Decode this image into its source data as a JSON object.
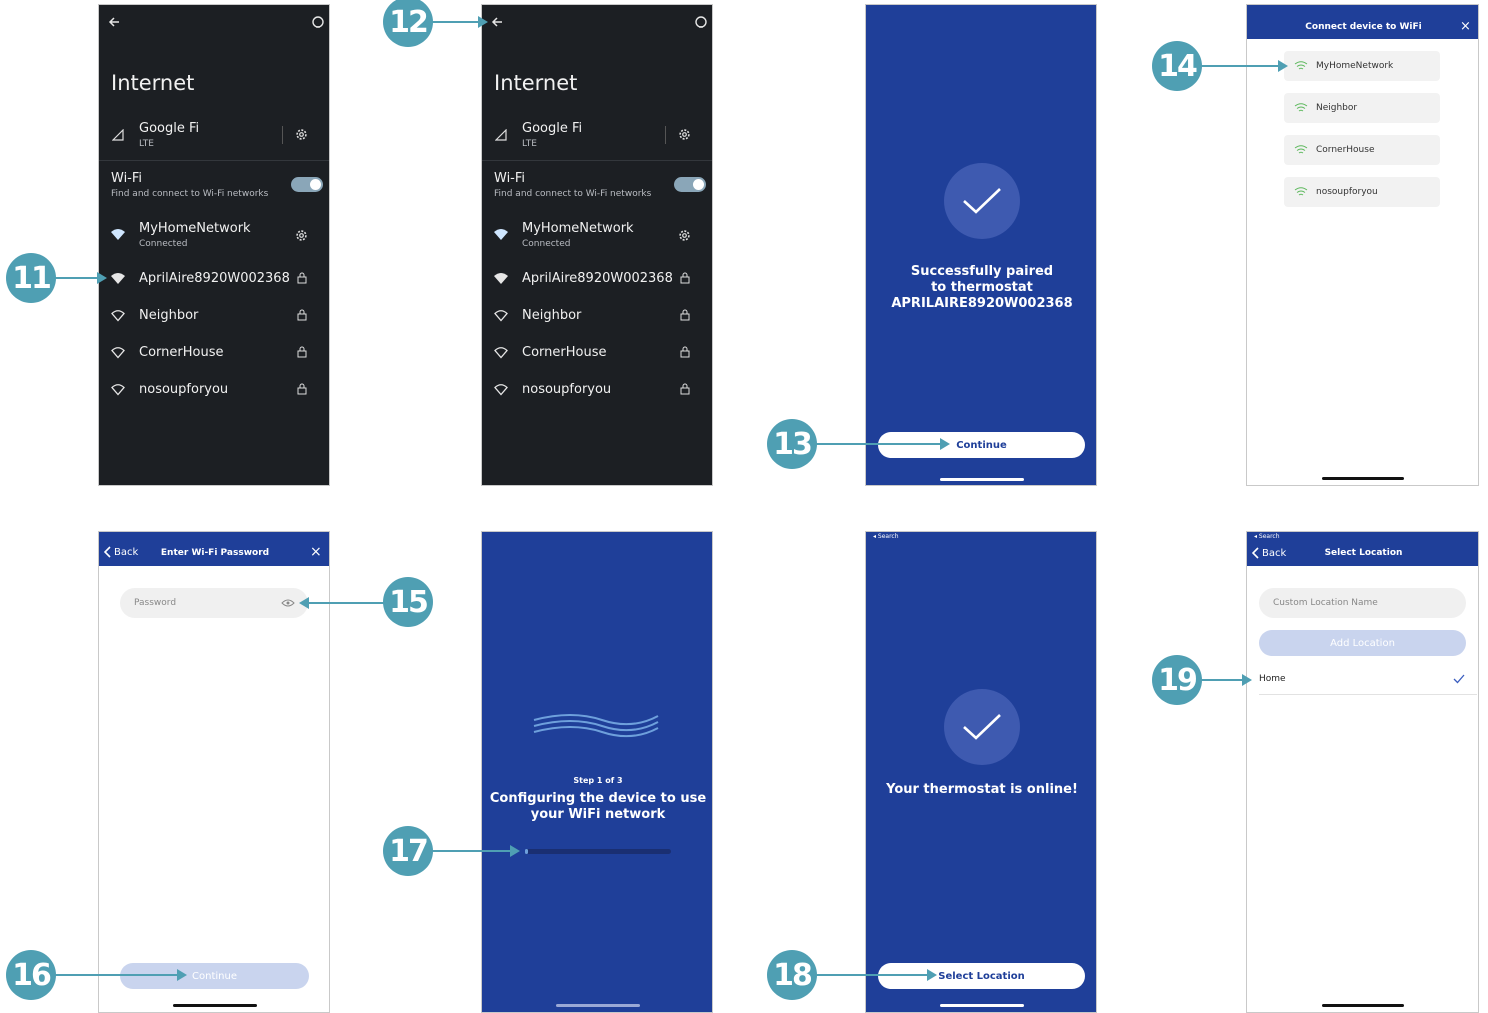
{
  "colors": {
    "accent": "#4f9fb3",
    "brand_blue": "#1f3f99",
    "dark_bg": "#1c1f23",
    "wifi_green": "#5cb85c"
  },
  "screen1": {
    "title": "Internet",
    "carrier": {
      "name": "Google Fi",
      "sub": "LTE"
    },
    "wifi": {
      "label": "Wi-Fi",
      "sub": "Find and connect to Wi-Fi networks"
    },
    "connected": {
      "name": "MyHomeNetwork",
      "sub": "Connected"
    },
    "networks": [
      "AprilAire8920W002368",
      "Neighbor",
      "CornerHouse",
      "nosoupforyou"
    ]
  },
  "screen2": {
    "title": "Internet",
    "carrier": {
      "name": "Google Fi",
      "sub": "LTE"
    },
    "wifi": {
      "label": "Wi-Fi",
      "sub": "Find and connect to Wi-Fi networks"
    },
    "connected": {
      "name": "MyHomeNetwork",
      "sub": "Connected"
    },
    "networks": [
      "AprilAire8920W002368",
      "Neighbor",
      "CornerHouse",
      "nosoupforyou"
    ]
  },
  "screen3": {
    "line1": "Successfully paired",
    "line2": "to thermostat",
    "line3": "APRILAIRE8920W002368",
    "button": "Continue"
  },
  "screen4": {
    "header": "Connect device to WiFi",
    "networks": [
      "MyHomeNetwork",
      "Neighbor",
      "CornerHouse",
      "nosoupforyou"
    ]
  },
  "screen5": {
    "back": "Back",
    "header": "Enter Wi-Fi Password",
    "placeholder": "Password",
    "button": "Continue"
  },
  "screen6": {
    "step": "Step 1 of 3",
    "line1": "Configuring the device to use",
    "line2": "your WiFi network"
  },
  "screen7": {
    "status": "◂ Search",
    "message": "Your thermostat is online!",
    "button": "Select Location"
  },
  "screen8": {
    "status": "◂ Search",
    "back": "Back",
    "header": "Select Location",
    "placeholder": "Custom Location Name",
    "add_button": "Add Location",
    "location": "Home"
  },
  "badges": [
    "11",
    "12",
    "13",
    "14",
    "15",
    "16",
    "17",
    "18",
    "19"
  ]
}
